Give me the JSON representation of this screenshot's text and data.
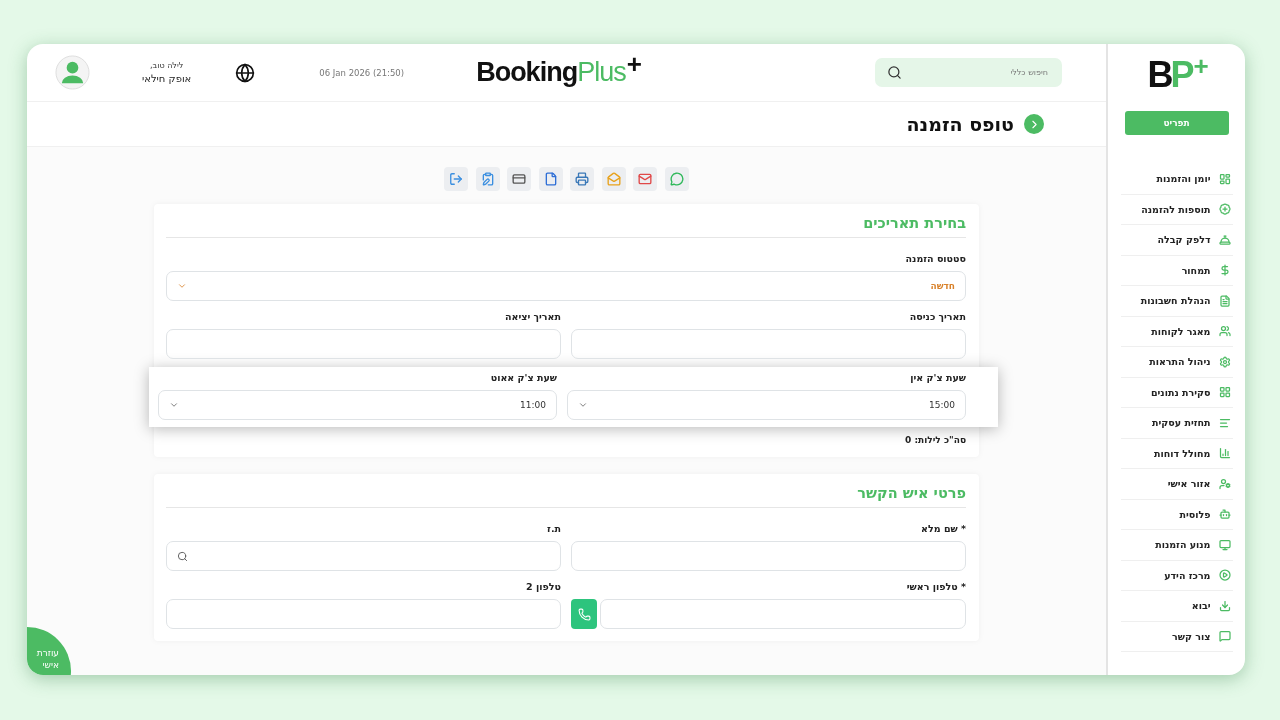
{
  "header": {
    "search": {
      "placeholder": "חיפוש כללי"
    },
    "logo": {
      "main": "Booking",
      "accent": "Plus",
      "mark": "+"
    },
    "date": "06 Jan 2026 (21:50)",
    "user": {
      "greeting": "לילה טוב,",
      "name": "אופק חילאי"
    }
  },
  "page_title": "טופס הזמנה",
  "sections": [
    {
      "title": "בחירת תאריכים",
      "rows": [
        {
          "kind": "single",
          "fields": [
            {
              "kind": "status_select",
              "label": "סטטוס הזמנה",
              "value": "חדשה"
            }
          ]
        },
        {
          "kind": "pair",
          "fields": [
            {
              "kind": "input",
              "label": "תאריך כניסה"
            },
            {
              "kind": "input",
              "label": "תאריך יציאה"
            }
          ]
        },
        {
          "kind": "raised",
          "fields": [
            {
              "kind": "select",
              "label": "שעת צ'ק אין",
              "value": "15:00"
            },
            {
              "kind": "select",
              "label": "שעת צ'ק אאוט",
              "value": "11:00"
            }
          ]
        },
        {
          "kind": "summary",
          "text": "סה\"כ לילות: 0"
        }
      ]
    },
    {
      "title": "פרטי איש הקשר",
      "rows": [
        {
          "kind": "pair",
          "fields": [
            {
              "kind": "input",
              "label": "* שם מלא"
            },
            {
              "kind": "search_input",
              "label": "ת.ז"
            }
          ]
        },
        {
          "kind": "pair",
          "fields": [
            {
              "kind": "phone_input",
              "label": "* טלפון ראשי"
            },
            {
              "kind": "input",
              "label": "טלפון 2"
            }
          ]
        }
      ]
    }
  ],
  "sidebar": {
    "logo": {
      "first": "B",
      "second": "P",
      "mark": "+"
    },
    "menu_button": "תפריט",
    "items": [
      {
        "label": "יומן והזמנות"
      },
      {
        "label": "תוספות להזמנה"
      },
      {
        "label": "דלפק קבלה"
      },
      {
        "label": "תמחור"
      },
      {
        "label": "הנהלת חשבונות"
      },
      {
        "label": "מאגר לקוחות"
      },
      {
        "label": "ניהול התראות"
      },
      {
        "label": "סקירת נתונים"
      },
      {
        "label": "תחזית עסקית"
      },
      {
        "label": "מחולל דוחות"
      },
      {
        "label": "אזור אישי"
      },
      {
        "label": "פלוסית"
      },
      {
        "label": "מנוע הזמנות"
      },
      {
        "label": "מרכז הידע"
      },
      {
        "label": "יבוא"
      },
      {
        "label": "צור קשר"
      }
    ]
  },
  "assistant": {
    "label": "עוזרת אישי"
  }
}
